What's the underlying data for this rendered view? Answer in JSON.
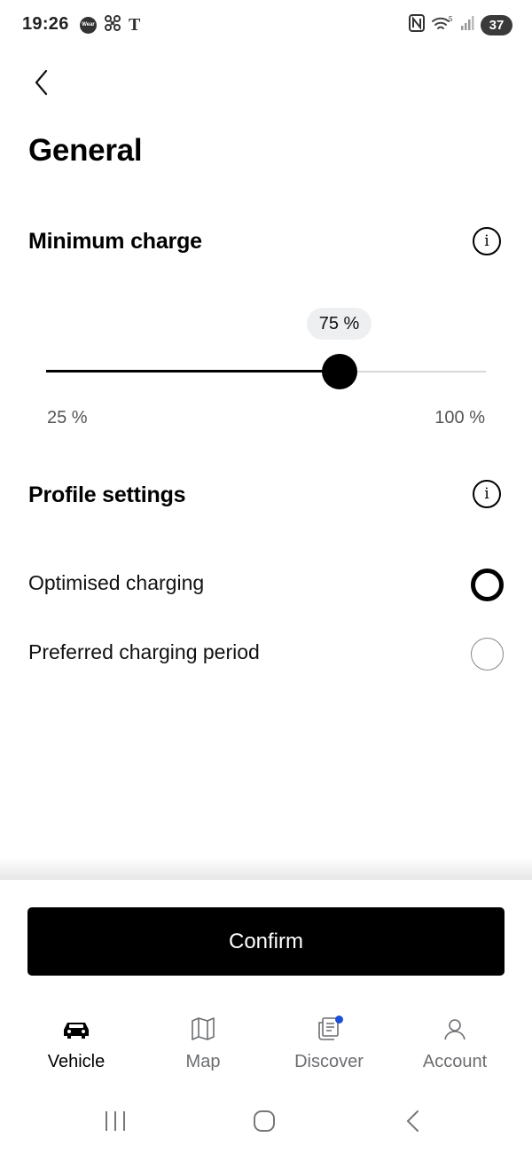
{
  "status_bar": {
    "time": "19:26",
    "wear_badge": "Wear",
    "t_glyph": "T",
    "battery": "37",
    "icons": [
      "wear-icon",
      "fan-icon",
      "t-icon",
      "nfc-icon",
      "wifi-icon",
      "signal-icon",
      "battery-icon"
    ]
  },
  "page": {
    "title": "General"
  },
  "minimum_charge": {
    "title": "Minimum charge",
    "value_label": "75 %",
    "value": 75,
    "min": 25,
    "max": 100,
    "min_label": "25 %",
    "max_label": "100 %"
  },
  "profile_settings": {
    "title": "Profile settings",
    "options": [
      {
        "label": "Optimised charging",
        "selected": true
      },
      {
        "label": "Preferred charging period",
        "selected": false
      }
    ]
  },
  "confirm_label": "Confirm",
  "bottom_nav": {
    "items": [
      {
        "label": "Vehicle",
        "icon": "car-icon",
        "active": true
      },
      {
        "label": "Map",
        "icon": "map-icon",
        "active": false
      },
      {
        "label": "Discover",
        "icon": "discover-icon",
        "active": false,
        "badge": true
      },
      {
        "label": "Account",
        "icon": "account-icon",
        "active": false
      }
    ]
  },
  "colors": {
    "accent": "#000000",
    "notification": "#1a4fd6",
    "muted_text": "#6b6d70"
  }
}
